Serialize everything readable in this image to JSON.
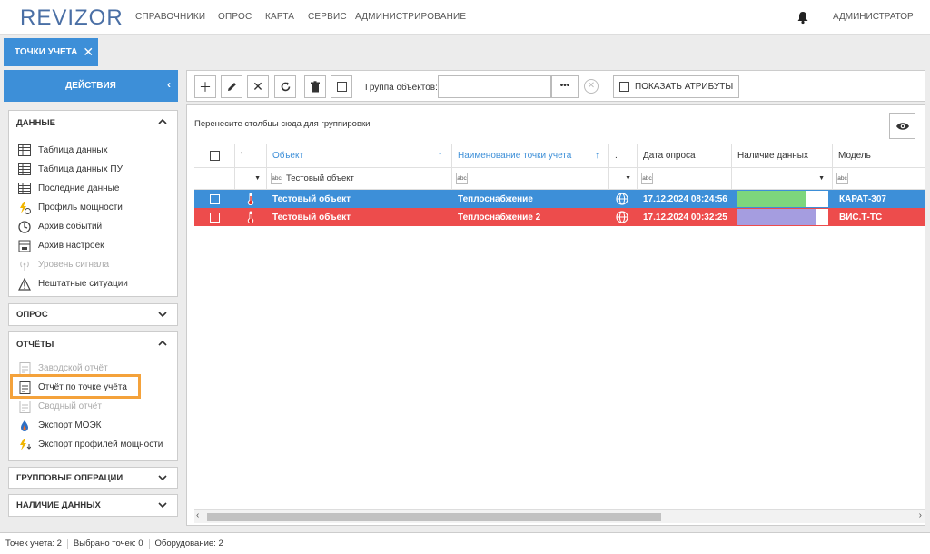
{
  "brand": {
    "logo": "REVIZOR"
  },
  "nav": [
    "СПРАВОЧНИКИ",
    "ОПРОС",
    "КАРТА",
    "СЕРВИС",
    "АДМИНИСТРИРОВАНИЕ"
  ],
  "user": "АДМИНИСТРАТОР",
  "tab": {
    "label": "ТОЧКИ УЧЕТА",
    "close": "✕"
  },
  "actions": {
    "label": "ДЕЙСТВИЯ"
  },
  "sidebar": {
    "data": {
      "title": "ДАННЫЕ",
      "items": [
        {
          "label": "Таблица данных",
          "icon": "table-icon",
          "disabled": false
        },
        {
          "label": "Таблица данных ПУ",
          "icon": "table-icon",
          "disabled": false
        },
        {
          "label": "Последние данные",
          "icon": "table-icon",
          "disabled": false
        },
        {
          "label": "Профиль мощности",
          "icon": "power-profile-icon",
          "disabled": false
        },
        {
          "label": "Архив событий",
          "icon": "clock-icon",
          "disabled": false
        },
        {
          "label": "Архив настроек",
          "icon": "settings-archive-icon",
          "disabled": false
        },
        {
          "label": "Уровень сигнала",
          "icon": "signal-icon",
          "disabled": true
        },
        {
          "label": "Нештатные ситуации",
          "icon": "warning-icon",
          "disabled": false
        }
      ]
    },
    "poll": {
      "title": "ОПРОС"
    },
    "reports": {
      "title": "ОТЧЁТЫ",
      "items": [
        {
          "label": "Заводской отчёт",
          "icon": "report-icon",
          "disabled": true
        },
        {
          "label": "Отчёт по точке учёта",
          "icon": "report-icon",
          "disabled": false
        },
        {
          "label": "Сводный отчёт",
          "icon": "report-icon",
          "disabled": true
        },
        {
          "label": "Экспорт МОЭК",
          "icon": "moek-icon",
          "disabled": false
        },
        {
          "label": "Экспорт профилей мощности",
          "icon": "power-export-icon",
          "disabled": false
        }
      ]
    },
    "group_ops": {
      "title": "ГРУППОВЫЕ ОПЕРАЦИИ"
    },
    "availability": {
      "title": "НАЛИЧИЕ ДАННЫХ"
    }
  },
  "toolbar": {
    "group_label": "Группа объектов:",
    "group_value": "",
    "more": "•••",
    "show_attrs": "ПОКАЗАТЬ АТРИБУТЫ"
  },
  "grid": {
    "group_hint": "Перенесите столбцы сюда для группировки",
    "columns": {
      "object": "Объект",
      "point_name": "Наименование точки учета",
      "dot": ".",
      "poll_date": "Дата опроса",
      "data_presence": "Наличие данных",
      "model": "Модель"
    },
    "filter": {
      "object_value": "Тестовый объект",
      "abc": "abc"
    },
    "rows": [
      {
        "object": "Тестовый объект",
        "point": "Теплоснабжение",
        "date": "17.12.2024 08:24:56",
        "model": "КАРАТ-307",
        "presence_color": "#7dd67d",
        "presence_fill": 0.88,
        "bg": "#3d8fd8"
      },
      {
        "object": "Тестовый объект",
        "point": "Теплоснабжение 2",
        "date": "17.12.2024 00:32:25",
        "model": "ВИС.Т-ТС",
        "presence_color": "#a59de0",
        "presence_fill": 1.0,
        "bg": "#ed4c4c"
      }
    ]
  },
  "status": {
    "points": "Точек учета: 2",
    "selected": "Выбрано точек: 0",
    "equipment": "Оборудование: 2"
  },
  "colors": {
    "accent": "#3d8fd8",
    "alarm_row": "#ed4c4c",
    "highlight": "#f4a23b"
  }
}
